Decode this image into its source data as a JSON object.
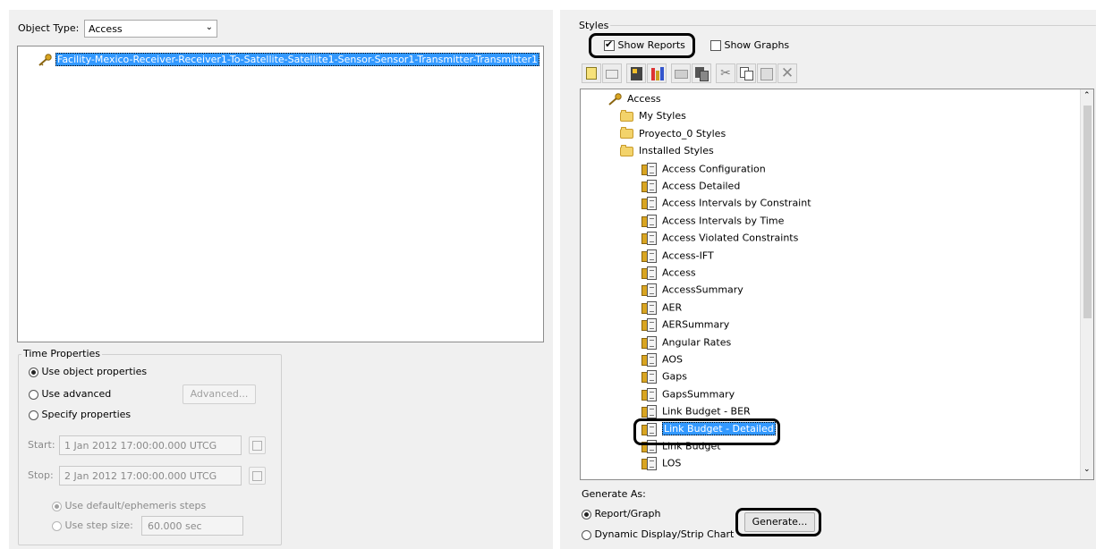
{
  "object_type": {
    "label": "Object Type:",
    "value": "Access"
  },
  "object_list": {
    "selected": "Facility-Mexico-Receiver-Receiver1-To-Satellite-Satellite1-Sensor-Sensor1-Transmitter-Transmitter1"
  },
  "time_properties": {
    "title": "Time Properties",
    "use_object": "Use object properties",
    "use_advanced": "Use advanced",
    "advanced_button": "Advanced...",
    "specify": "Specify properties",
    "start_label": "Start:",
    "start_value": "1 Jan 2012 17:00:00.000 UTCG",
    "stop_label": "Stop:",
    "stop_value": "2 Jan 2012 17:00:00.000 UTCG",
    "default_steps": "Use default/ephemeris steps",
    "step_size_label": "Use step size:",
    "step_size_value": "60.000 sec"
  },
  "styles": {
    "title": "Styles",
    "show_reports": "Show Reports",
    "show_reports_checked": true,
    "show_graphs": "Show Graphs",
    "show_graphs_checked": false,
    "toolbar_icons": [
      "new-style-icon",
      "new-folder-icon",
      "properties-icon",
      "graph-style-icon",
      "open-folder-icon",
      "copy-style-icon",
      "cut-icon",
      "copy-icon",
      "paste-icon",
      "delete-icon"
    ],
    "tree": {
      "root": "Access",
      "folders": [
        "My Styles",
        "Proyecto_0 Styles",
        "Installed Styles"
      ],
      "installed": [
        "Access Configuration",
        "Access Detailed",
        "Access Intervals by Constraint",
        "Access Intervals by Time",
        "Access Violated Constraints",
        "Access-IFT",
        "Access",
        "AccessSummary",
        "AER",
        "AERSummary",
        "Angular Rates",
        "AOS",
        "Gaps",
        "GapsSummary",
        "Link Budget - BER",
        "Link Budget - Detailed",
        "Link Budget",
        "LOS"
      ],
      "selected_item": "Link Budget - Detailed"
    }
  },
  "generate_as": {
    "title": "Generate As:",
    "report_graph": "Report/Graph",
    "dynamic": "Dynamic Display/Strip Chart",
    "generate_button": "Generate..."
  },
  "colors": {
    "selection": "#3399ff",
    "panel": "#f0f0f0"
  }
}
